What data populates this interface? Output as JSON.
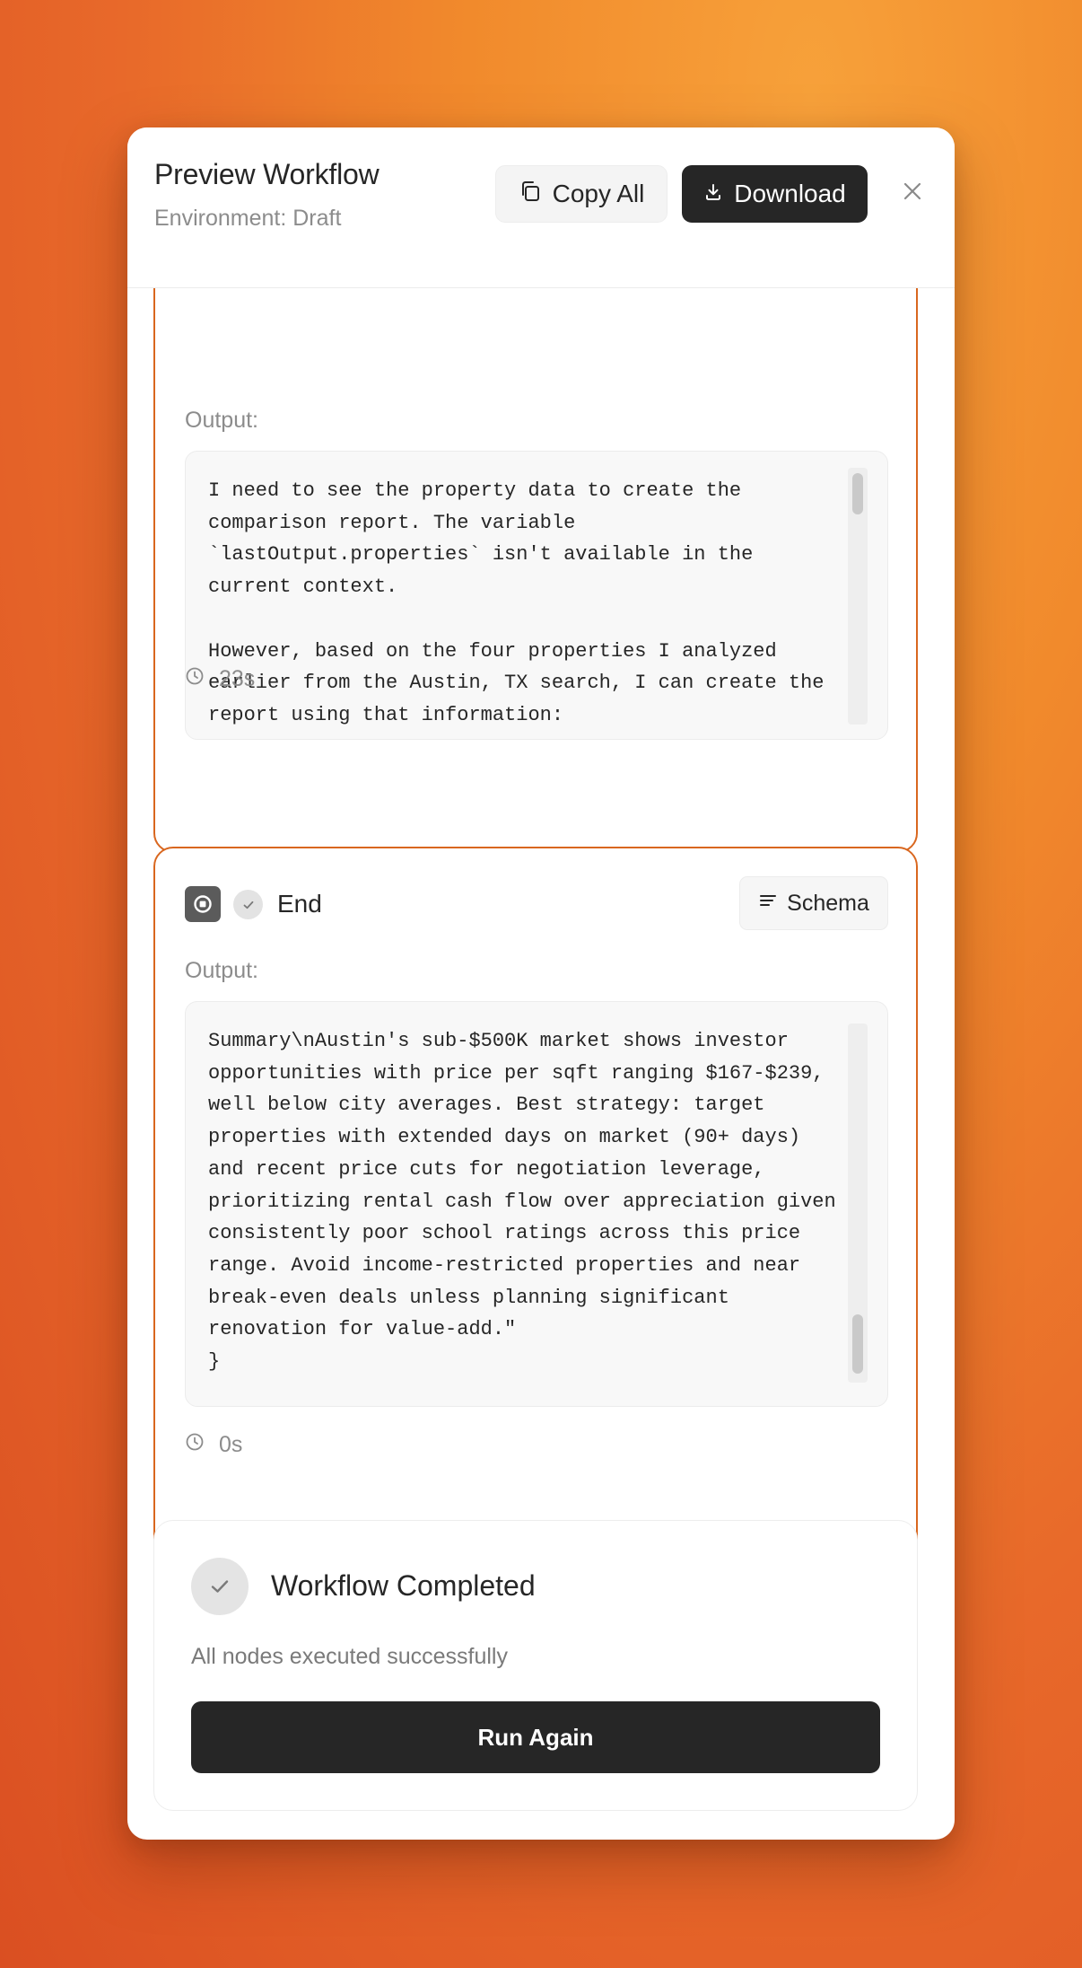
{
  "header": {
    "title": "Preview Workflow",
    "subtitle": "Environment: Draft",
    "copy_label": "Copy All",
    "download_label": "Download",
    "close_icon": "close-icon"
  },
  "nodes": [
    {
      "output_label": "Output:",
      "output_text": "I need to see the property data to create the comparison report. The variable `lastOutput.properties` isn't available in the current context.\n\nHowever, based on the four properties I analyzed earlier from the Austin, TX search, I can create the report using that information:\n\n# Property Comparison Report - Austin, TX",
      "duration": "23s"
    },
    {
      "title": "End",
      "schema_label": "Schema",
      "output_label": "Output:",
      "output_text": "Summary\\nAustin's sub-$500K market shows investor opportunities with price per sqft ranging $167-$239, well below city averages. Best strategy: target properties with extended days on market (90+ days) and recent price cuts for negotiation leverage, prioritizing rental cash flow over appreciation given consistently poor school ratings across this price range. Avoid income-restricted properties and near break-even deals unless planning significant renovation for value-add.\"\n}",
      "duration": "0s"
    }
  ],
  "completion": {
    "title": "Workflow Completed",
    "subtitle": "All nodes executed successfully",
    "run_again_label": "Run Again"
  },
  "colors": {
    "accent_border": "#d9671f",
    "primary_button": "#262626",
    "muted_text": "#8c8c8c"
  }
}
